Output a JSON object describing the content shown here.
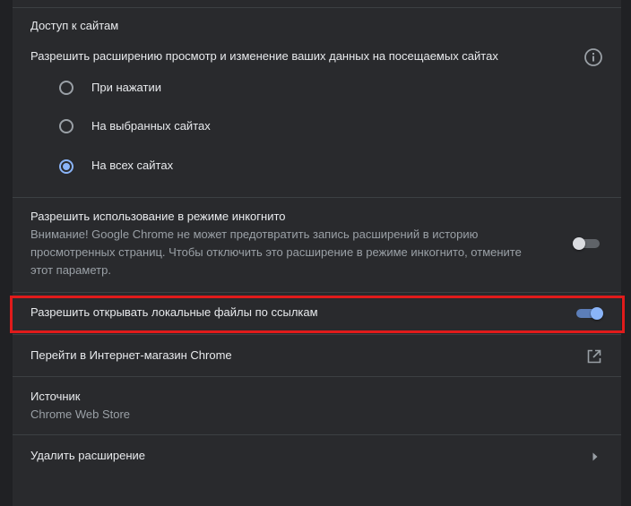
{
  "site_access": {
    "heading": "Доступ к сайтам",
    "permission_label": "Разрешить расширению просмотр и изменение ваших данных на посещаемых сайтах",
    "info_icon": "info-icon",
    "options": [
      {
        "label": "При нажатии",
        "selected": false
      },
      {
        "label": "На выбранных сайтах",
        "selected": false
      },
      {
        "label": "На всех сайтах",
        "selected": true
      }
    ]
  },
  "incognito": {
    "title": "Разрешить использование в режиме инкогнито",
    "description_line1": "Внимание! Google Chrome не может предотвратить запись расширений в историю",
    "description_line2": "просмотренных страниц. Чтобы отключить это расширение в режиме инкогнито, отмените",
    "description_line3": "этот параметр.",
    "enabled": false
  },
  "file_urls": {
    "label": "Разрешить открывать локальные файлы по ссылкам",
    "enabled": true
  },
  "webstore": {
    "label": "Перейти в Интернет-магазин Chrome",
    "icon": "open-in-new-icon"
  },
  "source": {
    "title": "Источник",
    "value": "Chrome Web Store"
  },
  "remove": {
    "label": "Удалить расширение",
    "icon": "chevron-right-icon"
  },
  "colors": {
    "background": "#202124",
    "card": "#292a2d",
    "accent": "#8ab4f8",
    "highlight": "#e01b1b"
  }
}
